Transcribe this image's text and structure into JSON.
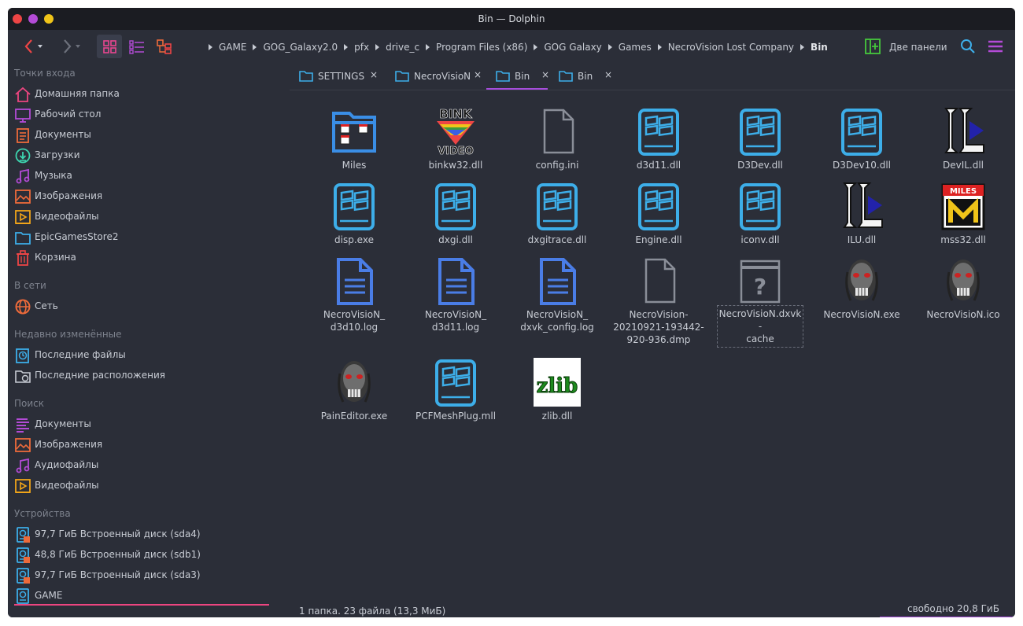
{
  "window": {
    "title": "Bin — Dolphin"
  },
  "toolbar": {
    "split_label": "Две панели",
    "breadcrumb": [
      "GAME",
      "GOG_Galaxy2.0",
      "pfx",
      "drive_c",
      "Program Files (x86)",
      "GOG Galaxy",
      "Games",
      "NecroVision Lost Company",
      "Bin"
    ]
  },
  "sidebar": {
    "sections": {
      "places": "Точки входа",
      "network": "В сети",
      "recent": "Недавно изменённые",
      "search": "Поиск",
      "devices": "Устройства"
    },
    "places": [
      "Домашняя папка",
      "Рабочий стол",
      "Документы",
      "Загрузки",
      "Музыка",
      "Изображения",
      "Видеофайлы",
      "EpicGamesStore2",
      "Корзина"
    ],
    "network": [
      "Сеть"
    ],
    "recent": [
      "Последние файлы",
      "Последние расположения"
    ],
    "search": [
      "Документы",
      "Изображения",
      "Аудиофайлы",
      "Видеофайлы"
    ],
    "devices": [
      "97,7 ГиБ Встроенный диск (sda4)",
      "48,8 ГиБ Встроенный диск (sdb1)",
      "97,7 ГиБ Встроенный диск (sda3)",
      "GAME"
    ],
    "device_game_fill": 0.97
  },
  "tabs": [
    {
      "label": "SETTINGS",
      "active": false
    },
    {
      "label": "NecroVisioN",
      "active": false
    },
    {
      "label": "Bin",
      "active": true
    },
    {
      "label": "Bin",
      "active": false
    }
  ],
  "files": [
    {
      "name": "Miles",
      "type": "folder"
    },
    {
      "name": "binkw32.dll",
      "type": "bink"
    },
    {
      "name": "config.ini",
      "type": "generic"
    },
    {
      "name": "d3d11.dll",
      "type": "win"
    },
    {
      "name": "D3Dev.dll",
      "type": "win"
    },
    {
      "name": "D3Dev10.dll",
      "type": "win"
    },
    {
      "name": "DevIL.dll",
      "type": "devil"
    },
    {
      "name": "disp.exe",
      "type": "win"
    },
    {
      "name": "dxgi.dll",
      "type": "win"
    },
    {
      "name": "dxgitrace.dll",
      "type": "win"
    },
    {
      "name": "Engine.dll",
      "type": "win"
    },
    {
      "name": "iconv.dll",
      "type": "win"
    },
    {
      "name": "ILU.dll",
      "type": "devil"
    },
    {
      "name": "mss32.dll",
      "type": "miles"
    },
    {
      "name": "NecroVisioN_\nd3d10.log",
      "type": "log"
    },
    {
      "name": "NecroVisioN_\nd3d11.log",
      "type": "log"
    },
    {
      "name": "NecroVisioN_\ndxvk_config.log",
      "type": "log"
    },
    {
      "name": "NecroVision-\n20210921-193442-\n920-936.dmp",
      "type": "generic"
    },
    {
      "name": "NecroVisioN.dxvk-\ncache",
      "type": "unknown"
    },
    {
      "name": "NecroVisioN.exe",
      "type": "skull"
    },
    {
      "name": "NecroVisioN.ico",
      "type": "skull"
    },
    {
      "name": "PainEditor.exe",
      "type": "skull"
    },
    {
      "name": "PCFMeshPlug.mll",
      "type": "win"
    },
    {
      "name": "zlib.dll",
      "type": "zlib"
    }
  ],
  "selected_file": "NecroVisioN.dxvk-\ncache",
  "status": {
    "summary": "1 папка. 23 файла (13,3 МиБ)",
    "free": "свободно 20,8 ГиБ"
  },
  "icons": {
    "bink_top": "BINK",
    "bink_bottom": "VIDEO",
    "miles": "MILES",
    "unknown": "?",
    "zlib": "zlib"
  },
  "colors": {
    "accent": "#a64ddc",
    "folder": "#3a8ee6",
    "win": "#3daee9",
    "close_red": "#ed4545",
    "min_purple": "#b34bd6",
    "max_yellow": "#f0c419"
  }
}
